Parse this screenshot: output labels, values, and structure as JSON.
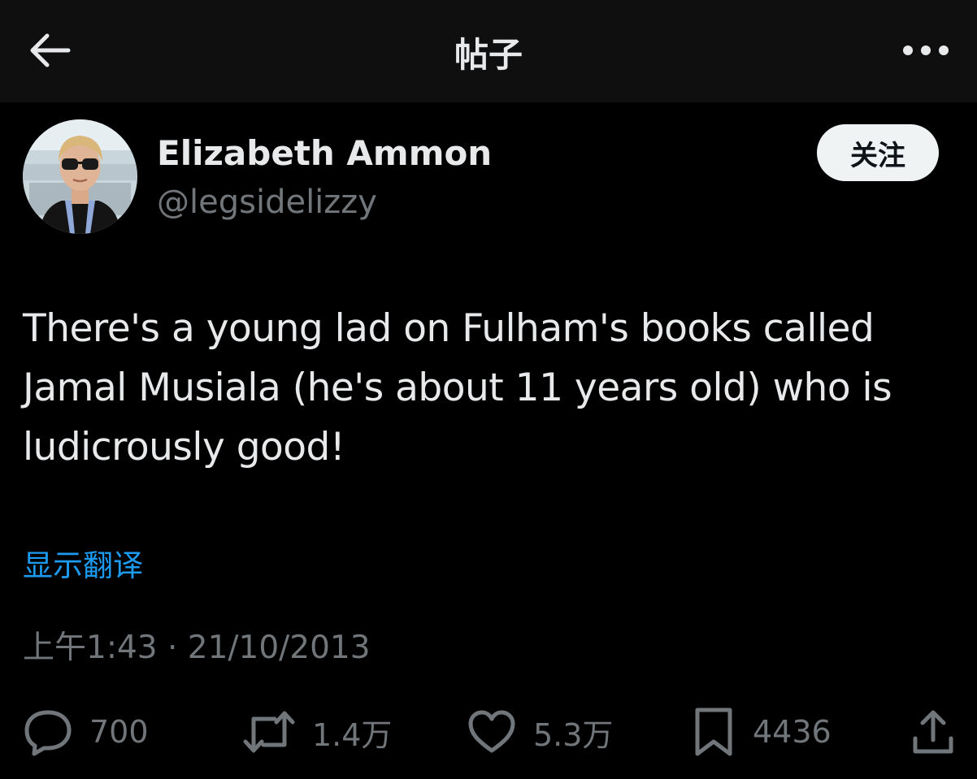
{
  "header": {
    "title": "帖子",
    "back_icon": "arrow-left-icon",
    "more_icon": "more-horizontal-icon"
  },
  "author": {
    "display_name": "Elizabeth Ammon",
    "handle": "@legsidelizzy",
    "follow_label": "关注"
  },
  "tweet": {
    "text": "There's a young lad on Fulham's books called Jamal Musiala (he's about 11 years old) who is ludicrously good!",
    "translate_label": "显示翻译",
    "timestamp": "上午1:43 · 21/10/2013"
  },
  "actions": {
    "replies": "700",
    "retweets": "1.4万",
    "likes": "5.3万",
    "bookmarks": "4436"
  },
  "colors": {
    "background": "#000000",
    "header_background": "#0f0f10",
    "text_primary": "#e7e9ea",
    "text_secondary": "#71767b",
    "link": "#1d9bf0",
    "follow_button_bg": "#eff3f4"
  }
}
